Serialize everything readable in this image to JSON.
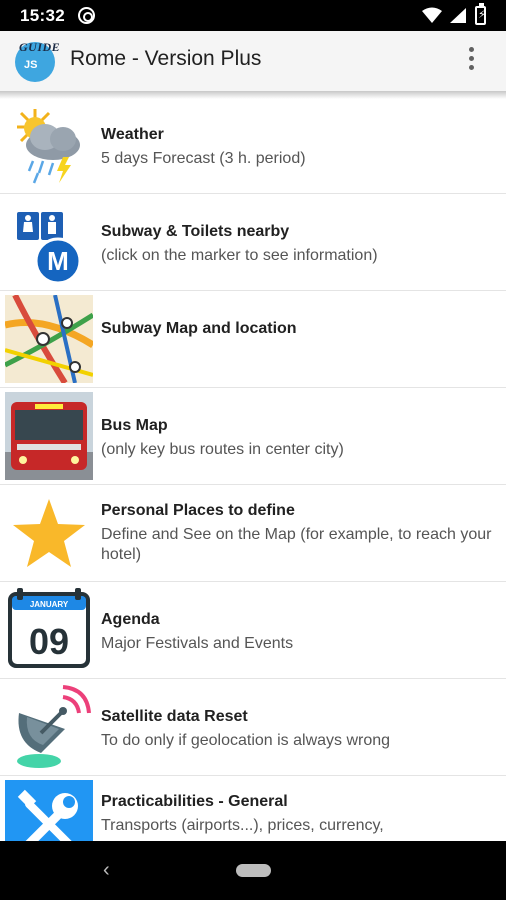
{
  "status_bar": {
    "time": "15:32",
    "icons": [
      "sync-icon",
      "wifi-icon",
      "signal-icon",
      "battery-charging-icon"
    ]
  },
  "app_bar": {
    "logo_text_top": "GUIDE",
    "logo_text_bottom": "JS",
    "title": "Rome - Version Plus",
    "menu_icon": "overflow-menu-icon"
  },
  "menu_items": [
    {
      "title": "Weather",
      "subtitle": "5 days Forecast (3 h. period)",
      "icon": "weather-storm-icon"
    },
    {
      "title": "Subway & Toilets nearby",
      "subtitle": "(click on the marker to see information)",
      "icon": "toilets-metro-icon"
    },
    {
      "title": "Subway Map and location",
      "subtitle": "",
      "icon": "subway-map-icon"
    },
    {
      "title": "Bus Map",
      "subtitle": "(only key bus routes in center city)",
      "icon": "bus-icon"
    },
    {
      "title": "Personal Places to define",
      "subtitle": "Define and See on the Map (for example, to reach your hotel)",
      "icon": "star-icon"
    },
    {
      "title": "Agenda",
      "subtitle": "Major Festivals and Events",
      "calendar_month": "JANUARY",
      "calendar_day": "09",
      "icon": "calendar-icon"
    },
    {
      "title": "Satellite data Reset",
      "subtitle": "To do only if geolocation is always wrong",
      "icon": "satellite-dish-icon"
    },
    {
      "title": "Practicabilities - General",
      "subtitle": "Transports (airports...), prices, currency,",
      "icon": "tools-icon"
    }
  ],
  "nav_bar": {
    "back_icon": "back-icon",
    "home_icon": "home-pill-icon"
  },
  "colors": {
    "status_bar": "#000000",
    "app_bar": "#f5f5f5",
    "logo": "#3ea6e0",
    "star": "#f9b82a",
    "metro_badge": "#1565c0",
    "tools_bg": "#2196f3"
  }
}
